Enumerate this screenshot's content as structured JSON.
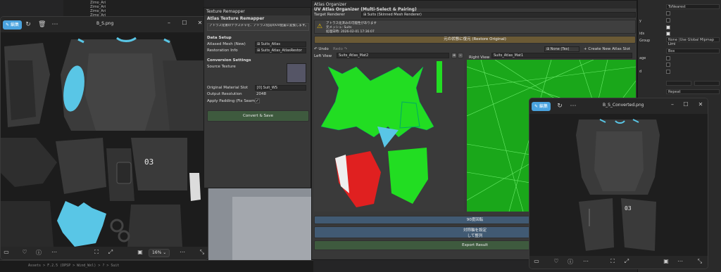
{
  "unity": {
    "hierarchy_rows": [
      "Zimo_Ari",
      "Zimo_Ari",
      "Zimo_Ari",
      "Zimo_Ari"
    ],
    "bottom_path": "Assets > F.2.5 (DPSP > Wind_Wxl) > ? > Suit"
  },
  "inspector": {
    "fields": [
      "ToNearest",
      "",
      "None (Use Global Mipmap Limi",
      "Box",
      "Repeat"
    ],
    "labels": [
      "y",
      "ids",
      "Group",
      "age",
      "d"
    ]
  },
  "viewer_left": {
    "edit_label": "編集",
    "filename": "B_S.png",
    "zoom": "16%"
  },
  "remapper": {
    "window_title": "Texture Remapper",
    "header": "Atlas Texture Remapper",
    "note": "アトラス化後のテクスチャを、アトラス化前のUV配置に変換します。",
    "data_setup": "Data Setup",
    "atlased_mesh_label": "Atlased Mesh (New)",
    "atlased_mesh_value": "Suits_Atlas",
    "restoration_label": "Restoration Info",
    "restoration_value": "Suits_Atlas_AtlasRestor",
    "conversion": "Conversion Settings",
    "source_texture": "Source Texture",
    "material_slot_label": "Original Material Slot",
    "material_slot_value": "[0] Suit_WS",
    "resolution_label": "Output Resolution",
    "resolution_value": "2048",
    "padding_label": "Apply Padding (Fix Seams)",
    "convert_button": "Convert & Save"
  },
  "organizer": {
    "window_title": "Atlas Organizer",
    "header": "UV Atlas Organizer (Multi-Select & Pairing)",
    "target_label": "Target Renderer",
    "target_value": "Suits (Skinned Mesh Renderer)",
    "warning_line1": "アトラス化済みの可能性があります",
    "warning_line2": "元メッシュ: Suits",
    "warning_line3": "処理日時: 2026-02-01 17:36:07",
    "restore_button": "元の状態に復元 (Restore Original)",
    "undo": "↶ Undo",
    "redo": "Redo ↷",
    "none_tex": "None (Tex)",
    "create_slot": "+ Create New Atlas Slot",
    "left_view_label": "Left View",
    "left_view_value": "Suits_Atlas_Mat2",
    "right_view_label": "Right View",
    "right_view_value": "Suits_Atlas_Mat1",
    "rotate_button": "90度回転",
    "pair_button_line1": "対称軸を設定",
    "pair_button_line2": "して整列",
    "export_button": "Export Result"
  },
  "viewer_right": {
    "edit_label": "編集",
    "filename": "B_S_Converted.png"
  },
  "colors": {
    "accent": "#4aa3df",
    "uv_green": "#22dd22",
    "uv_red": "#e02020",
    "uv_cyan": "#59c6e6",
    "restore_bar": "#6b5a35",
    "convert_btn": "#3e5a3e"
  }
}
